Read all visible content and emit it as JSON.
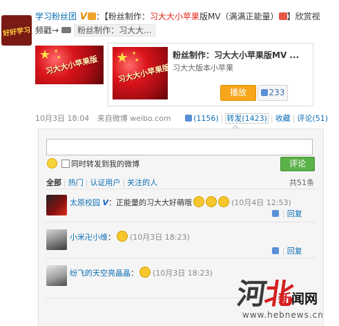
{
  "post": {
    "author": "学习粉丝团",
    "verified_label": "V",
    "text_prefix": "：【粉丝制作：",
    "highlight": "习大大小苹果",
    "text_middle": "版MV（满满正能量）",
    "text_suffix": "】欣赏视",
    "text_line2": "频戳→",
    "video_tag": "粉丝制作：习大大..."
  },
  "avatar_text": "好好学习",
  "video_card": {
    "thumb_title": "习大大小苹果版",
    "title": "粉丝制作：习大大小苹果版MV ...",
    "subtitle": "习大大版本小苹果",
    "play_label": "播放",
    "like_count": "233"
  },
  "meta": {
    "time": "10月3日 18:04",
    "source_prefix": "来自",
    "source": "微博 weibo.com",
    "likes": "(1156)",
    "forward": "转发(1423)",
    "favorite": "收藏",
    "comment": "评论(51)"
  },
  "comment_box": {
    "checkbox_label": "同时转发到我的微博",
    "submit_label": "评论",
    "filters": [
      "全部",
      "热门",
      "认证用户",
      "关注的人"
    ],
    "total": "共51条"
  },
  "comments": [
    {
      "user": "太原校园",
      "verified": "V",
      "text": "：正能量的习大大好萌哦",
      "emoji_count": 3,
      "time": "(10月4日 12:53)",
      "reply": "回复"
    },
    {
      "user": "小米卍小维",
      "text": "：",
      "emoji_count": 1,
      "time": "(10月3日 18:23)",
      "reply": "回复"
    },
    {
      "user": "纷飞的天空亮晶晶",
      "text": "：",
      "emoji_count": 1,
      "time": "(10月3日 18:23)",
      "reply": "回复"
    }
  ],
  "watermark": {
    "logo_a": "河",
    "logo_b": "北",
    "name_a": "新",
    "name_b": "闻网",
    "url": "www.hebnews.cn"
  },
  "colors": {
    "link": "#0a6fb5",
    "highlight": "#e0261a",
    "play": "#f7a51b",
    "submit": "#5bb24a"
  }
}
